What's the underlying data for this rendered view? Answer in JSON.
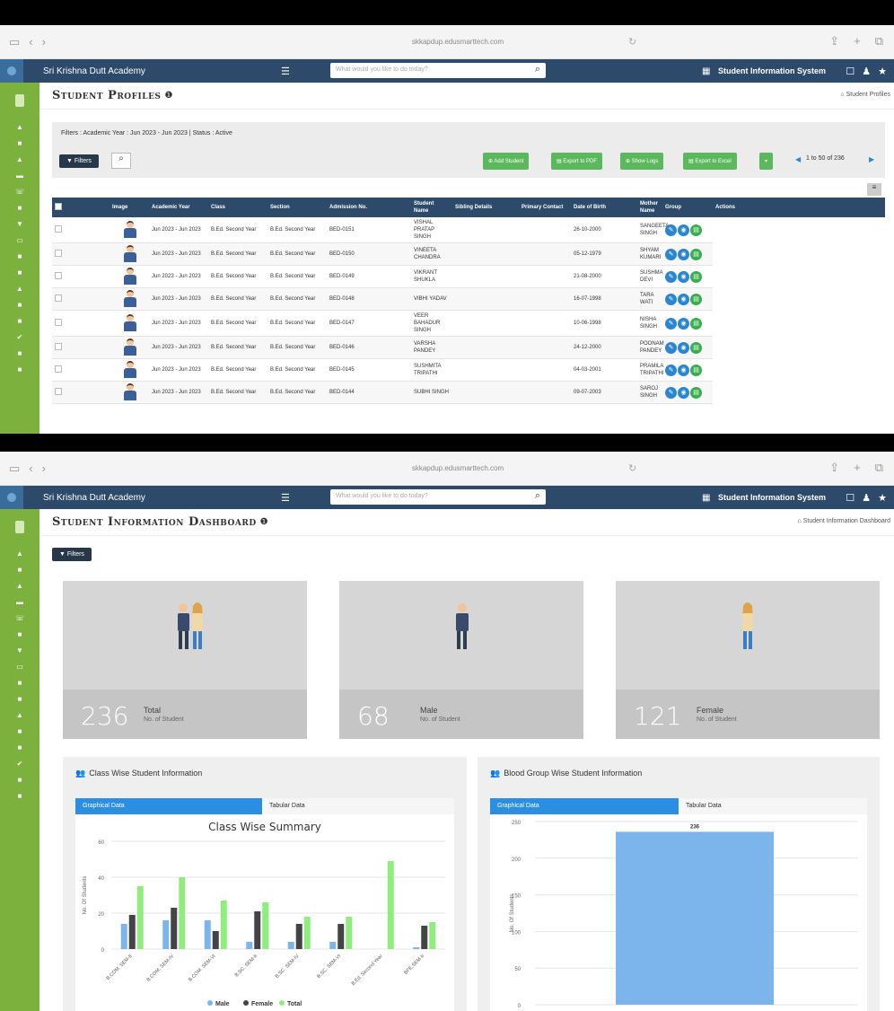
{
  "browser": {
    "url": "skkapdup.edusmarttech.com"
  },
  "app": {
    "name": "Sri Krishna Dutt Academy",
    "search_placeholder": "What would you like to do today?",
    "system_title": "Student Information System"
  },
  "profiles": {
    "title": "Student Profiles",
    "breadcrumb": "Student Profiles",
    "filters_text": "Filters : Academic Year : Jun 2023 - Jun 2023 | Status : Active",
    "filters_button": "Filters",
    "buttons": {
      "add": "Add Student",
      "pdf": "Export to PDF",
      "logs": "Show Logs",
      "excel": "Export to Excel"
    },
    "pagination": "1 to 50 of 236",
    "columns": [
      "Image",
      "Academic Year",
      "Class",
      "Section",
      "Admission No.",
      "Student Name",
      "Sibling Details",
      "Primary Contact",
      "Date of Birth",
      "Mother Name",
      "Group",
      "Actions"
    ],
    "rows": [
      {
        "year": "Jun 2023 - Jun 2023",
        "class": "B.Ed. Second Year",
        "section": "B.Ed. Second Year",
        "adm": "BED-0151",
        "name": "VISHAL PRATAP SINGH",
        "dob": "26-10-2000",
        "mother": "SANGEETA SINGH"
      },
      {
        "year": "Jun 2023 - Jun 2023",
        "class": "B.Ed. Second Year",
        "section": "B.Ed. Second Year",
        "adm": "BED-0150",
        "name": "VINEETA CHANDRA",
        "dob": "05-12-1979",
        "mother": "SHYAM KUMARI"
      },
      {
        "year": "Jun 2023 - Jun 2023",
        "class": "B.Ed. Second Year",
        "section": "B.Ed. Second Year",
        "adm": "BED-0149",
        "name": "VIKRANT SHUKLA",
        "dob": "21-08-2000",
        "mother": "SUSHMA DEVI"
      },
      {
        "year": "Jun 2023 - Jun 2023",
        "class": "B.Ed. Second Year",
        "section": "B.Ed. Second Year",
        "adm": "BED-0148",
        "name": "VIBHI YADAV",
        "dob": "16-07-1998",
        "mother": "TARA WATI"
      },
      {
        "year": "Jun 2023 - Jun 2023",
        "class": "B.Ed. Second Year",
        "section": "B.Ed. Second Year",
        "adm": "BED-0147",
        "name": "VEER BAHADUR SINGH",
        "dob": "10-06-1998",
        "mother": "NISHA SINGH"
      },
      {
        "year": "Jun 2023 - Jun 2023",
        "class": "B.Ed. Second Year",
        "section": "B.Ed. Second Year",
        "adm": "BED-0146",
        "name": "VARSHA PANDEY",
        "dob": "24-12-2000",
        "mother": "POONAM PANDEY"
      },
      {
        "year": "Jun 2023 - Jun 2023",
        "class": "B.Ed. Second Year",
        "section": "B.Ed. Second Year",
        "adm": "BED-0145",
        "name": "SUSHMITA TRIPATHI",
        "dob": "04-03-2001",
        "mother": "PRAMILA TRIPATHI"
      },
      {
        "year": "Jun 2023 - Jun 2023",
        "class": "B.Ed. Second Year",
        "section": "B.Ed. Second Year",
        "adm": "BED-0144",
        "name": "SUBHI SINGH",
        "dob": "09-07-2003",
        "mother": "SAROJ SINGH"
      }
    ]
  },
  "dashboard": {
    "title": "Student Information Dashboard",
    "breadcrumb": "Student Information Dashboard",
    "filters_button": "Filters",
    "stats": [
      {
        "value": "236",
        "label": "Total",
        "sub": "No. of Student"
      },
      {
        "value": "68",
        "label": "Male",
        "sub": "No. of Student"
      },
      {
        "value": "121",
        "label": "Female",
        "sub": "No. of Student"
      }
    ],
    "panel_left": {
      "title": "Class Wise Student Information",
      "tab_graph": "Graphical Data",
      "tab_table": "Tabular Data"
    },
    "panel_right": {
      "title": "Blood Group Wise Student Information",
      "tab_graph": "Graphical Data",
      "tab_table": "Tabular Data"
    }
  },
  "chart_data": [
    {
      "type": "bar",
      "title": "Class Wise Summary",
      "ylabel": "No. Of Students",
      "ylim": [
        0,
        60
      ],
      "yticks": [
        0,
        20,
        40,
        60
      ],
      "categories": [
        "B.COM. SEM-II",
        "B.COM. SEM-IV",
        "B.COM. SEM-VI",
        "B.SC. SEM-II",
        "B.SC. SEM-IV",
        "B.SC. SEM-VI",
        "B.Ed. Second Year",
        "BFE.SEM-II"
      ],
      "series": [
        {
          "name": "Male",
          "color": "#7cb5ec",
          "values": [
            14,
            16,
            16,
            4,
            4,
            4,
            0,
            1
          ]
        },
        {
          "name": "Female",
          "color": "#434348",
          "values": [
            19,
            23,
            10,
            21,
            14,
            14,
            0,
            13
          ]
        },
        {
          "name": "Total",
          "color": "#90ed7d",
          "values": [
            35,
            40,
            27,
            26,
            18,
            18,
            49,
            15
          ]
        }
      ],
      "legend": "bottom"
    },
    {
      "type": "bar",
      "ylabel": "No. Of Students",
      "ylim": [
        0,
        250
      ],
      "yticks": [
        0,
        50,
        100,
        150,
        200,
        250
      ],
      "series": [
        {
          "color": "#7cb5ec",
          "values": [
            236
          ]
        }
      ],
      "data_labels": [
        "236"
      ]
    }
  ]
}
